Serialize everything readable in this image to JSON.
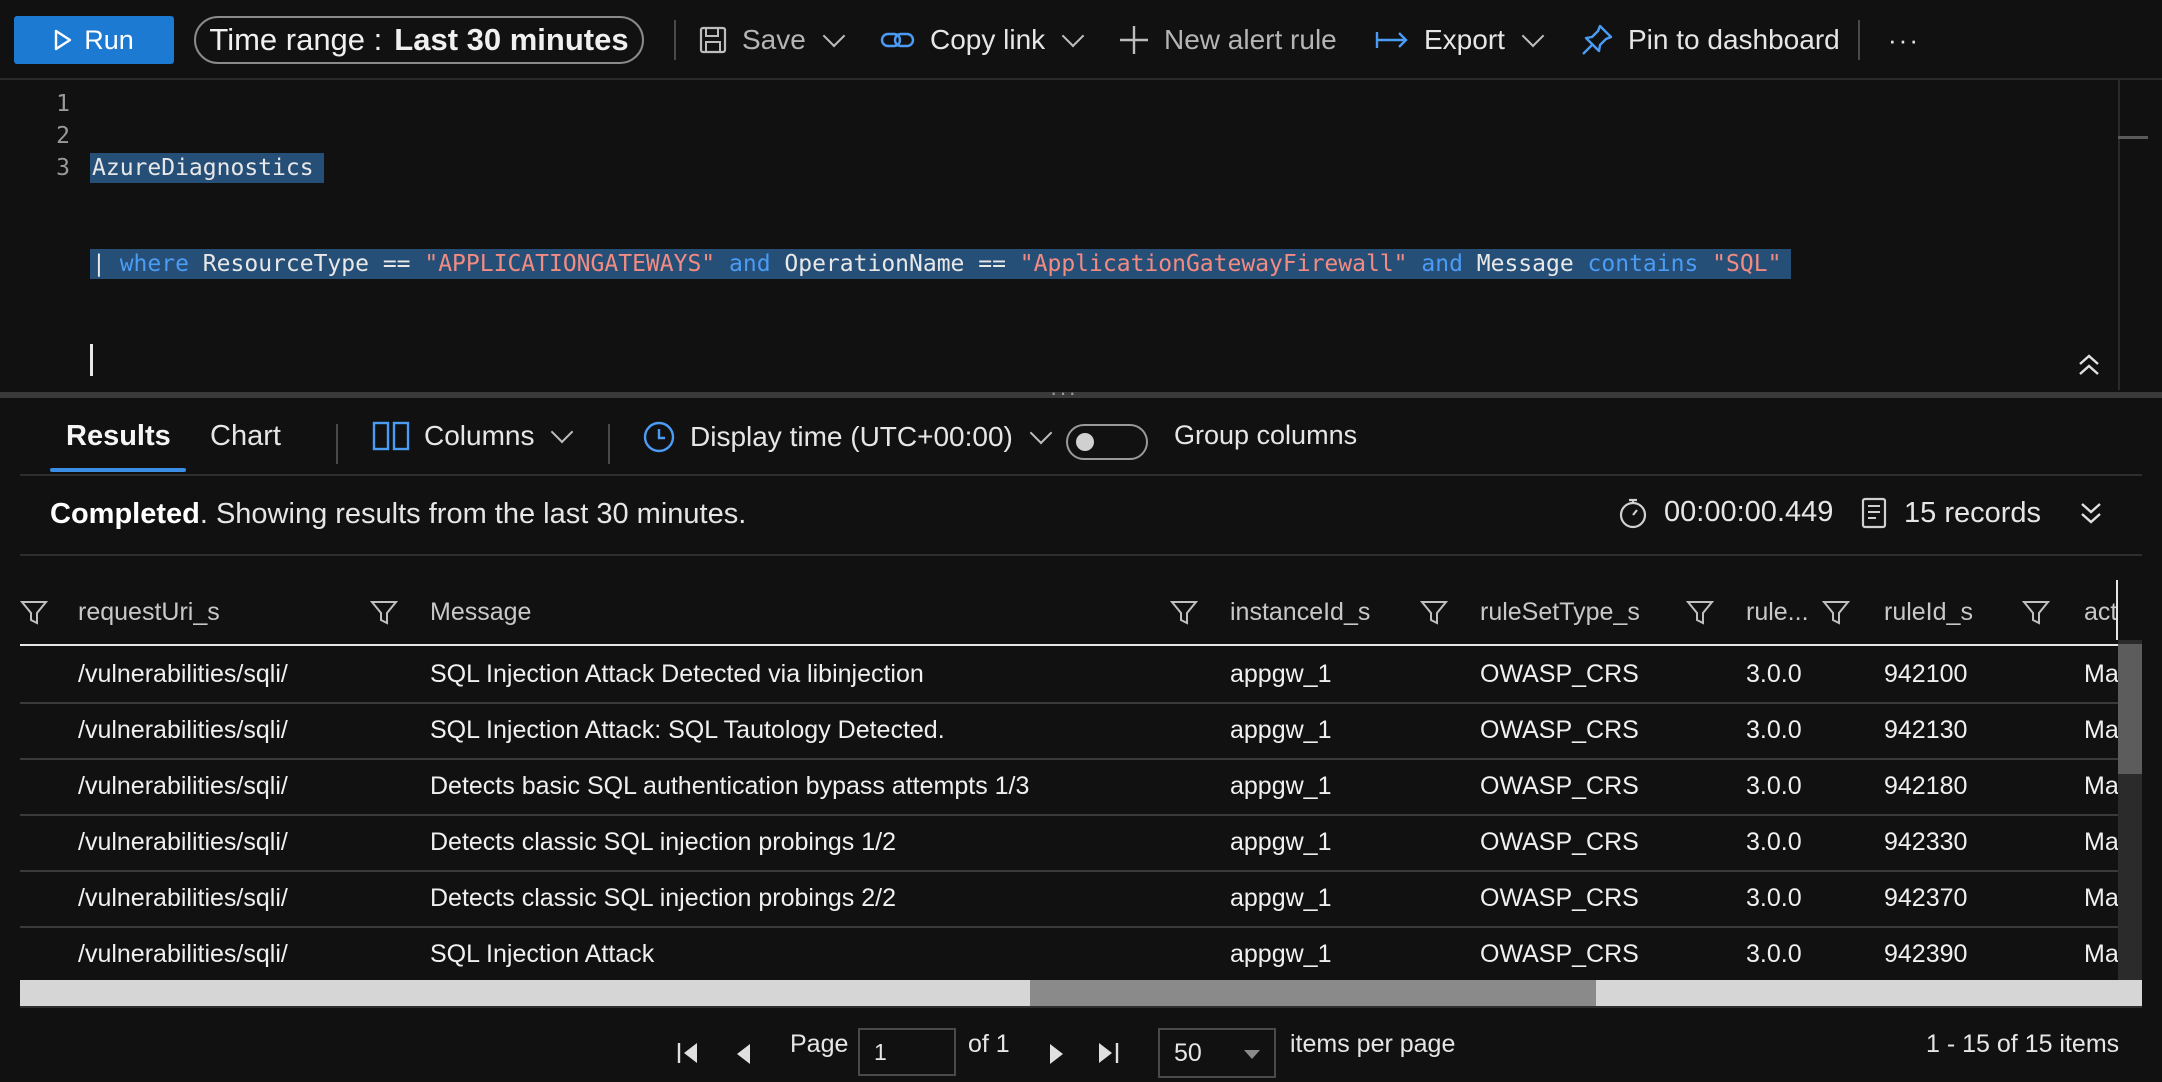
{
  "toolbar": {
    "run_label": "Run",
    "time_range_label": "Time range :",
    "time_range_value": "Last 30 minutes",
    "save_label": "Save",
    "copy_link_label": "Copy link",
    "new_alert_label": "New alert rule",
    "export_label": "Export",
    "pin_label": "Pin to dashboard",
    "more_label": "···"
  },
  "editor": {
    "line_numbers": [
      "1",
      "2",
      "3"
    ],
    "line1": "AzureDiagnostics",
    "line2": {
      "pipe": "| ",
      "where": "where",
      "f1": " ResourceType == ",
      "s1": "\"APPLICATIONGATEWAYS\"",
      "and1": " and",
      "f2": " OperationName == ",
      "s2": "\"ApplicationGatewayFirewall\"",
      "and2": " and",
      "f3": " Message ",
      "contains": "contains",
      "s3": " \"SQL\""
    }
  },
  "results": {
    "tabs": [
      "Results",
      "Chart"
    ],
    "columns_label": "Columns",
    "display_time_label": "Display time (UTC+00:00)",
    "group_columns_label": "Group columns",
    "group_columns_on": false,
    "status_bold": "Completed",
    "status_text": ". Showing results from the last 30 minutes.",
    "duration": "00:00:00.449",
    "records": "15 records"
  },
  "grid": {
    "headers": [
      "requestUri_s",
      "Message",
      "instanceId_s",
      "ruleSetType_s",
      "rule...",
      "ruleId_s",
      "act"
    ],
    "rows": [
      [
        "/vulnerabilities/sqli/",
        "SQL Injection Attack Detected via libinjection",
        "appgw_1",
        "OWASP_CRS",
        "3.0.0",
        "942100",
        "Ma"
      ],
      [
        "/vulnerabilities/sqli/",
        "SQL Injection Attack: SQL Tautology Detected.",
        "appgw_1",
        "OWASP_CRS",
        "3.0.0",
        "942130",
        "Ma"
      ],
      [
        "/vulnerabilities/sqli/",
        "Detects basic SQL authentication bypass attempts 1/3",
        "appgw_1",
        "OWASP_CRS",
        "3.0.0",
        "942180",
        "Ma"
      ],
      [
        "/vulnerabilities/sqli/",
        "Detects classic SQL injection probings 1/2",
        "appgw_1",
        "OWASP_CRS",
        "3.0.0",
        "942330",
        "Ma"
      ],
      [
        "/vulnerabilities/sqli/",
        "Detects classic SQL injection probings 2/2",
        "appgw_1",
        "OWASP_CRS",
        "3.0.0",
        "942370",
        "Ma"
      ],
      [
        "/vulnerabilities/sqli/",
        "SQL Injection Attack",
        "appgw_1",
        "OWASP_CRS",
        "3.0.0",
        "942390",
        "Ma"
      ]
    ]
  },
  "pager": {
    "page_label": "Page",
    "page_value": "1",
    "of_label": "of 1",
    "per_page_value": "50",
    "per_page_label": "items per page",
    "summary": "1 - 15 of 15 items"
  },
  "colors": {
    "accent": "#1d7ad3",
    "selection": "#264f78",
    "keyword": "#4b9cf5",
    "string": "#f28b82"
  }
}
